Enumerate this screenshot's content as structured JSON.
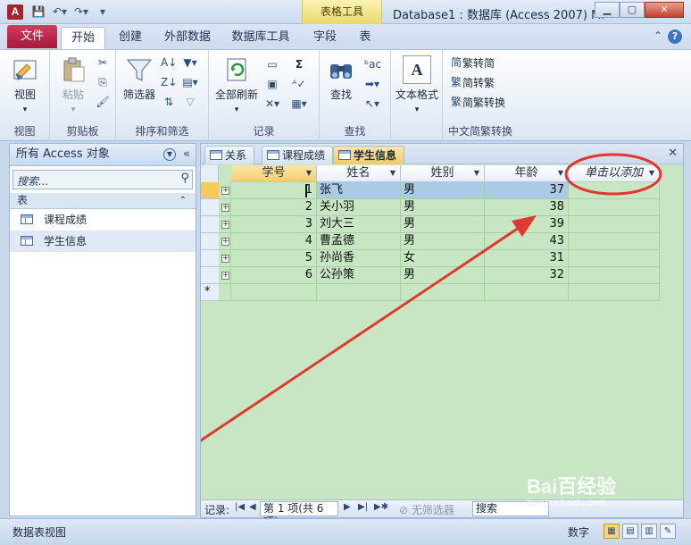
{
  "window": {
    "app_icon": "A",
    "title": "Database1 : 数据库 (Access 2007) M.",
    "context_tab_header": "表格工具"
  },
  "tabs": {
    "file": "文件",
    "items": [
      "开始",
      "创建",
      "外部数据",
      "数据库工具",
      "字段",
      "表"
    ],
    "active": "开始"
  },
  "ribbon": {
    "view": {
      "button": "视图",
      "group": "视图"
    },
    "clipboard": {
      "paste": "粘贴",
      "group": "剪贴板"
    },
    "sort_filter": {
      "filter": "筛选器",
      "group": "排序和筛选"
    },
    "records": {
      "refresh": "全部刷新",
      "group": "记录"
    },
    "find": {
      "find": "查找",
      "group": "查找"
    },
    "text_format": {
      "button": "文本格式",
      "icon_letter": "A"
    },
    "chinese_convert": {
      "trad": "繁转简",
      "simp": "简转繁",
      "convert": "简繁转换",
      "group": "中文简繁转换"
    }
  },
  "nav": {
    "header": "所有 Access 对象",
    "search_placeholder": "搜索...",
    "section": "表",
    "items": [
      "课程成绩",
      "学生信息"
    ]
  },
  "doc": {
    "tabs": [
      "关系",
      "课程成绩",
      "学生信息"
    ],
    "active_tab": "学生信息",
    "columns": [
      "学号",
      "姓名",
      "姓别",
      "年龄",
      "单击以添加"
    ],
    "rows": [
      {
        "id": "1",
        "name": "张飞",
        "gender": "男",
        "age": "37"
      },
      {
        "id": "2",
        "name": "关小羽",
        "gender": "男",
        "age": "38"
      },
      {
        "id": "3",
        "name": "刘大三",
        "gender": "男",
        "age": "39"
      },
      {
        "id": "4",
        "name": "曹孟德",
        "gender": "男",
        "age": "43"
      },
      {
        "id": "5",
        "name": "孙尚香",
        "gender": "女",
        "age": "31"
      },
      {
        "id": "6",
        "name": "公孙策",
        "gender": "男",
        "age": "32"
      }
    ],
    "new_row_marker": "*"
  },
  "record_nav": {
    "label": "记录:",
    "position": "第 1 项(共 6 项)",
    "filter": "无筛选器",
    "search": "搜索"
  },
  "status": {
    "left": "数据表视图",
    "right": "数字"
  },
  "watermark": {
    "brand": "Bai百经验",
    "url": "jingyan.baidu.com"
  },
  "colors": {
    "annotation": "#e0392f",
    "datasheet_bg": "#c8e6c4",
    "file_tab": "#b9244a"
  }
}
